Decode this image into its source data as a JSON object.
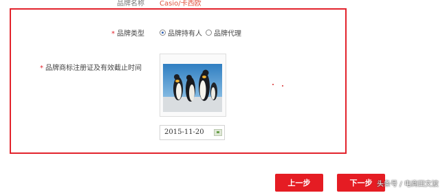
{
  "brand_name": {
    "label": "品牌名称",
    "value": "Casio/卡西欧"
  },
  "brand_type": {
    "label": "品牌类型",
    "options": [
      {
        "label": "品牌持有人",
        "selected": true
      },
      {
        "label": "品牌代理",
        "selected": false
      }
    ]
  },
  "trademark": {
    "label": "品牌商标注册证及有效截止时间",
    "image_icon": "penguins-photo",
    "expiry_date": "2015-11-20"
  },
  "required_mark": "*",
  "buttons": {
    "prev": "上一步",
    "next": "下一步"
  },
  "watermark": "头条号 / 电商田文波",
  "colors": {
    "accent": "#e51c23",
    "link": "#e0533f",
    "highlight": "#e2222b"
  }
}
